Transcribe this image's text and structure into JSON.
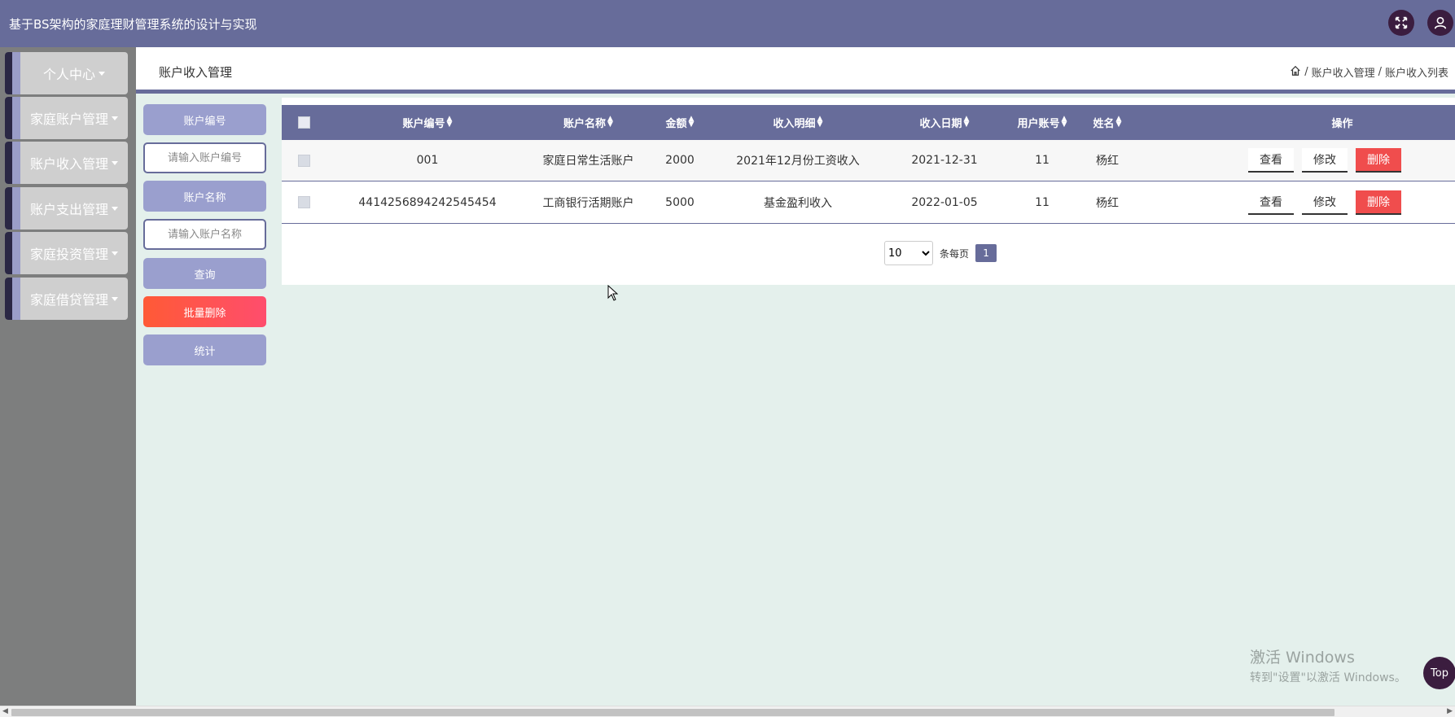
{
  "app": {
    "title": "基于BS架构的家庭理财管理系统的设计与实现"
  },
  "topbar": {
    "fullscreen_icon": "expand-icon",
    "user_icon": "user-icon"
  },
  "sidebar": {
    "items": [
      {
        "label": "个人中心"
      },
      {
        "label": "家庭账户管理"
      },
      {
        "label": "账户收入管理"
      },
      {
        "label": "账户支出管理"
      },
      {
        "label": "家庭投资管理"
      },
      {
        "label": "家庭借贷管理"
      }
    ]
  },
  "header": {
    "title": "账户收入管理",
    "breadcrumb": {
      "sep": "/",
      "level1": "账户收入管理",
      "level2": "账户收入列表"
    }
  },
  "search": {
    "account_no_label": "账户编号",
    "account_no_placeholder": "请输入账户编号",
    "account_name_label": "账户名称",
    "account_name_placeholder": "请输入账户名称",
    "query_label": "查询",
    "batch_delete_label": "批量删除",
    "stats_label": "统计"
  },
  "table": {
    "columns": {
      "account_no": "账户编号",
      "account_name": "账户名称",
      "amount": "金额",
      "detail": "收入明细",
      "date": "收入日期",
      "user_account": "用户账号",
      "name": "姓名",
      "actions": "操作"
    },
    "rows": [
      {
        "account_no": "001",
        "account_name": "家庭日常生活账户",
        "amount": "2000",
        "detail": "2021年12月份工资收入",
        "date": "2021-12-31",
        "user_account": "11",
        "name": "杨红"
      },
      {
        "account_no": "4414256894242545454",
        "account_name": "工商银行活期账户",
        "amount": "5000",
        "detail": "基金盈利收入",
        "date": "2022-01-05",
        "user_account": "11",
        "name": "杨红"
      }
    ],
    "action_labels": {
      "view": "查看",
      "edit": "修改",
      "delete": "删除"
    }
  },
  "pagination": {
    "page_size": "10",
    "per_page_label": "条每页",
    "current_page": "1"
  },
  "watermark": {
    "line1": "激活 Windows",
    "line2": "转到\"设置\"以激活 Windows。"
  },
  "back_to_top": "Top",
  "colors": {
    "primary": "#676c9a",
    "danger": "#f04d4d",
    "dark": "#3b1d3f",
    "sidebar_bg": "#7d7e7e",
    "content_bg": "#e4f0ec"
  }
}
